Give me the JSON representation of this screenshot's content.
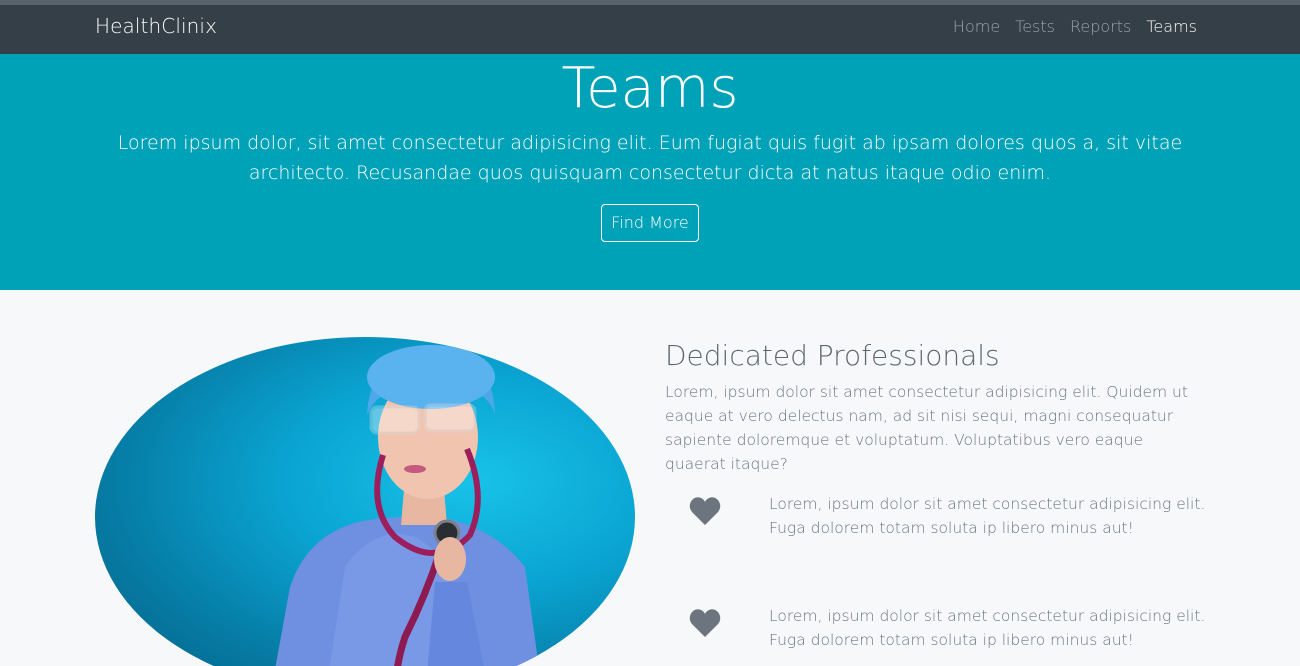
{
  "navbar": {
    "brand": "HealthClinix",
    "links": [
      {
        "label": "Home",
        "active": false
      },
      {
        "label": "Tests",
        "active": false
      },
      {
        "label": "Reports",
        "active": false
      },
      {
        "label": "Teams",
        "active": true
      }
    ]
  },
  "hero": {
    "title": "Teams",
    "text": "Lorem ipsum dolor, sit amet consectetur adipisicing elit. Eum fugiat quis fugit ab ipsam dolores quos a, sit vitae architecto. Recusandae quos quisquam consectetur dicta at natus itaque odio enim.",
    "button_label": "Find More"
  },
  "about": {
    "title": "Dedicated Professionals",
    "text": "Lorem, ipsum dolor sit amet consectetur adipisicing elit. Quidem ut eaque at vero delectus nam, ad sit nisi sequi, magni consequatur sapiente doloremque et voluptatum. Voluptatibus vero eaque quaerat itaque?",
    "image_icon": "doctor-photo",
    "features": [
      {
        "icon": "heart-icon",
        "text": "Lorem, ipsum dolor sit amet consectetur adipisicing elit. Fuga dolorem totam soluta ip libero minus aut!"
      },
      {
        "icon": "heart-icon",
        "text": "Lorem, ipsum dolor sit amet consectetur adipisicing elit. Fuga dolorem totam soluta ip libero minus aut!"
      }
    ]
  },
  "colors": {
    "navbar_bg": "#343f48",
    "hero_bg": "#00a2b8",
    "page_bg": "#f7f8fa",
    "icon_color": "#6c757d"
  }
}
